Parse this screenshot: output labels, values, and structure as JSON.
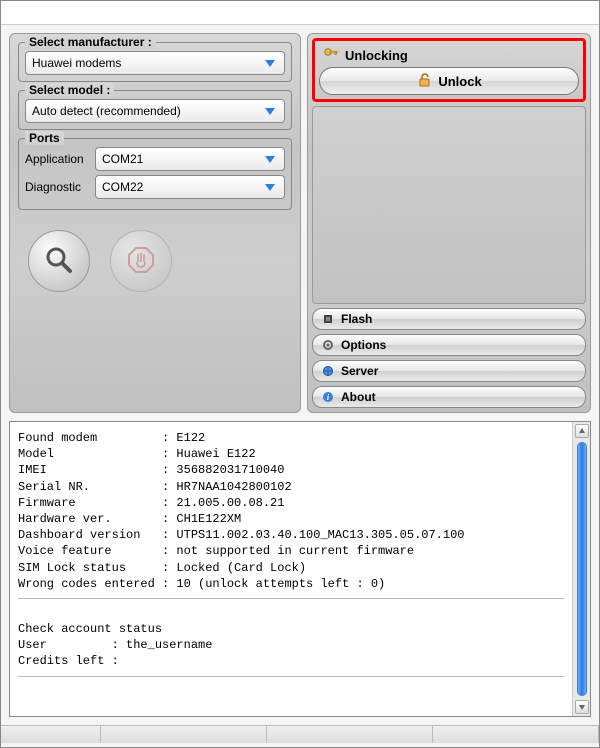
{
  "left": {
    "manufacturer": {
      "label": "Select manufacturer :",
      "value": "Huawei modems"
    },
    "model": {
      "label": "Select model :",
      "value": "Auto detect (recommended)"
    },
    "ports": {
      "label": "Ports",
      "application": {
        "label": "Application",
        "value": "COM21"
      },
      "diagnostic": {
        "label": "Diagnostic",
        "value": "COM22"
      }
    }
  },
  "right": {
    "unlocking": {
      "title": "Unlocking",
      "button": "Unlock"
    },
    "tabs": {
      "flash": "Flash",
      "options": "Options",
      "server": "Server",
      "about": "About"
    }
  },
  "log": {
    "rows": [
      [
        "Found modem",
        "E122"
      ],
      [
        "Model",
        "Huawei E122"
      ],
      [
        "IMEI",
        "356882031710040"
      ],
      [
        "Serial NR.",
        "HR7NAA1042800102"
      ],
      [
        "Firmware",
        "21.005.00.08.21"
      ],
      [
        "Hardware ver.",
        "CH1E122XM"
      ],
      [
        "Dashboard version",
        "UTPS11.002.03.40.100_MAC13.305.05.07.100"
      ],
      [
        "Voice feature",
        "not supported in current firmware"
      ],
      [
        "SIM Lock status",
        "Locked (Card Lock)"
      ],
      [
        "Wrong codes entered",
        "10 (unlock attempts left : 0)"
      ]
    ],
    "account_header": "Check account status",
    "user_label": "User",
    "user_value": "the_username",
    "credits_label": "Credits left",
    "credits_value": ""
  }
}
